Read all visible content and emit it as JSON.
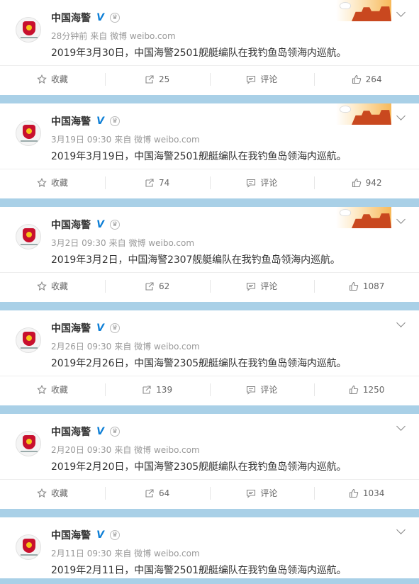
{
  "posts": [
    {
      "name": "中国海警",
      "time": "28分钟前",
      "source": "来自 微博 weibo.com",
      "text": "2019年3月30日，中国海警2501舰艇编队在我钓鱼岛领海内巡航。",
      "fav_label": "收藏",
      "repost": "25",
      "comment_label": "评论",
      "like": "264",
      "has_decor": true
    },
    {
      "name": "中国海警",
      "time": "3月19日 09:30",
      "source": "来自 微博 weibo.com",
      "text": "2019年3月19日，中国海警2501舰艇编队在我钓鱼岛领海内巡航。",
      "fav_label": "收藏",
      "repost": "74",
      "comment_label": "评论",
      "like": "942",
      "has_decor": true
    },
    {
      "name": "中国海警",
      "time": "3月2日 09:30",
      "source": "来自 微博 weibo.com",
      "text": "2019年3月2日，中国海警2307舰艇编队在我钓鱼岛领海内巡航。",
      "fav_label": "收藏",
      "repost": "62",
      "comment_label": "评论",
      "like": "1087",
      "has_decor": true
    },
    {
      "name": "中国海警",
      "time": "2月26日 09:30",
      "source": "来自 微博 weibo.com",
      "text": "2019年2月26日，中国海警2305舰艇编队在我钓鱼岛领海内巡航。",
      "fav_label": "收藏",
      "repost": "139",
      "comment_label": "评论",
      "like": "1250",
      "has_decor": false
    },
    {
      "name": "中国海警",
      "time": "2月20日 09:30",
      "source": "来自 微博 weibo.com",
      "text": "2019年2月20日，中国海警2305舰艇编队在我钓鱼岛领海内巡航。",
      "fav_label": "收藏",
      "repost": "64",
      "comment_label": "评论",
      "like": "1034",
      "has_decor": false
    },
    {
      "name": "中国海警",
      "time": "2月11日 09:30",
      "source": "来自 微博 weibo.com",
      "text": "2019年2月11日，中国海警2501舰艇编队在我钓鱼岛领海内巡航。",
      "has_decor": false
    }
  ],
  "icons": {
    "verified": "V",
    "member": "crown-icon",
    "fav": "star-icon",
    "repost": "repost-icon",
    "comment": "comment-icon",
    "like": "thumbs-up-icon"
  },
  "colors": {
    "background": "#a9d0e7",
    "verified": "#0e7fd6",
    "text": "#333333",
    "meta": "#999999"
  }
}
